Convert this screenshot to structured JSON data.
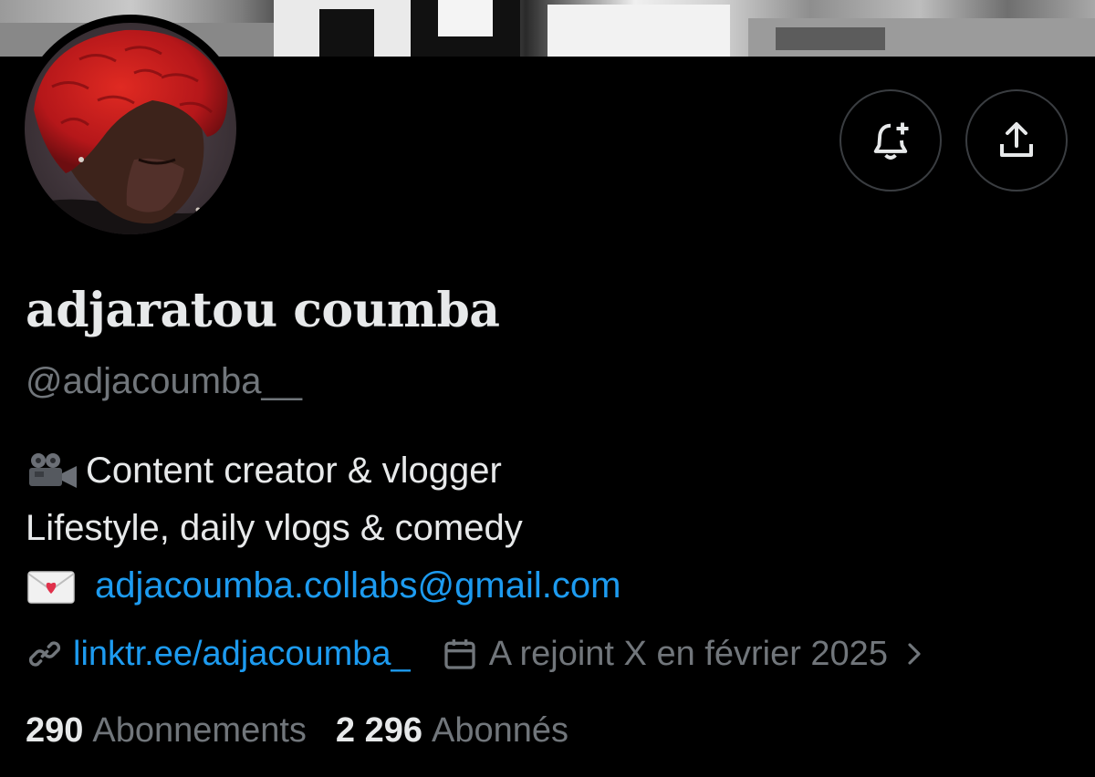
{
  "profile": {
    "display_name": "adjaratou coumba",
    "handle": "@adjacoumba__",
    "bio": {
      "line1_emoji": "🎥",
      "line1_text": "Content creator & vlogger",
      "line2_text": "Lifestyle, daily vlogs & comedy",
      "line3_emoji": "💌",
      "email": "adjacoumba.collabs@gmail.com"
    },
    "website": "linktr.ee/adjacoumba_",
    "joined": "A rejoint X en février 2025",
    "following_count": "290",
    "following_label": "Abonnements",
    "followers_count": "2 296",
    "followers_label": "Abonnés"
  },
  "actions": {
    "notify_icon": "bell-plus-icon",
    "share_icon": "share-upload-icon"
  },
  "colors": {
    "background": "#000000",
    "text_primary": "#e7e9ea",
    "text_secondary": "#71767b",
    "link": "#1d9bf0",
    "button_border": "#3a3d41"
  }
}
